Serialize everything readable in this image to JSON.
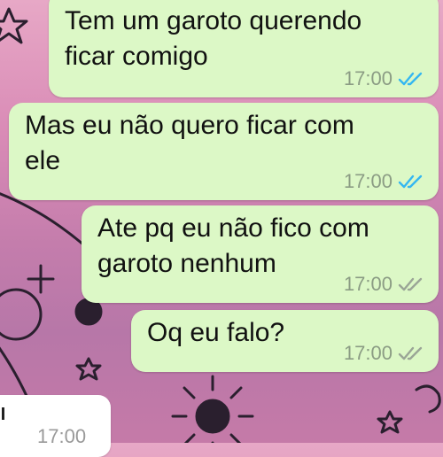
{
  "chat": {
    "messages": [
      {
        "text": "Tem um garoto querendo\nficar comigo",
        "time": "17:00",
        "status": "read"
      },
      {
        "text": "Mas eu não quero ficar com\nele",
        "time": "17:00",
        "status": "read"
      },
      {
        "text": "Ate pq eu não fico com\ngaroto nenhum",
        "time": "17:00",
        "status": "delivered"
      },
      {
        "text": "Oq eu falo?",
        "time": "17:00",
        "status": "delivered"
      }
    ],
    "incoming_time": "17:00"
  },
  "colors": {
    "outgoing_bubble": "#dcf8c6",
    "incoming_bubble": "#ffffff",
    "read_ticks": "#34b7f1",
    "delivered_ticks": "#9aa596"
  }
}
